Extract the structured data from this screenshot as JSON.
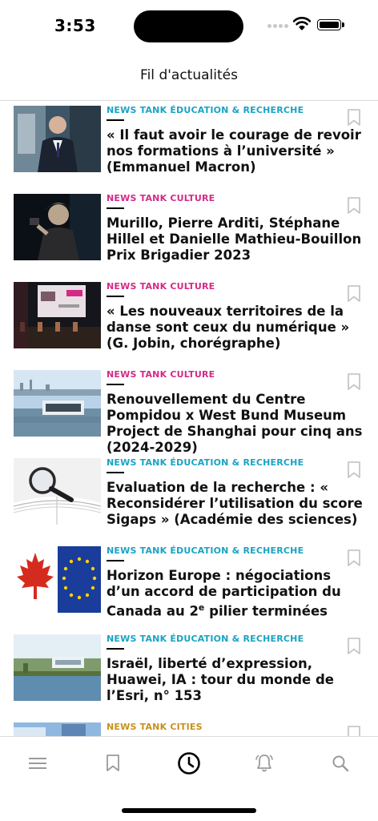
{
  "status_bar": {
    "time": "3:53"
  },
  "nav": {
    "title": "Fil d'actualités"
  },
  "colors": {
    "education": "#1aa3c4",
    "culture": "#d42a86",
    "cities": "#c8901a"
  },
  "feed": {
    "items": [
      {
        "category": "NEWS TANK ÉDUCATION & RECHERCHE",
        "headline": "« Il faut avoir le courage de revoir nos formations à l’université » (Emmanuel Macron)"
      },
      {
        "category": "NEWS TANK CULTURE",
        "headline": "Murillo, Pierre Arditi, Stéphane Hillel et Danielle Mathieu-Bouillon Prix Brigadier 2023"
      },
      {
        "category": "NEWS TANK CULTURE",
        "headline": "« Les nouveaux territoires de la danse sont ceux du numérique » (G. Jobin, chorégraphe)"
      },
      {
        "category": "NEWS TANK CULTURE",
        "headline": "Renouvellement du Centre Pompidou x West Bund Museum Project de Shanghai pour cinq ans (2024-2029)"
      },
      {
        "category": "NEWS TANK ÉDUCATION & RECHERCHE",
        "headline": "Evaluation de la recherche : « Reconsidérer l’utilisation du score Sigaps » (Académie des sciences)"
      },
      {
        "category": "NEWS TANK ÉDUCATION & RECHERCHE",
        "headline_main": "Horizon Europe : négociations d’un accord de participation du Canada au 2",
        "headline_sup": "e",
        "headline_end": " pilier terminées"
      },
      {
        "category": "NEWS TANK ÉDUCATION & RECHERCHE",
        "headline": "Israël, liberté d’expression, Huawei, IA : tour du monde de l’Esri, n° 153"
      },
      {
        "category": "NEWS TANK CITIES",
        "headline": ""
      }
    ]
  },
  "tabbar": {
    "tabs": [
      {
        "icon": "menu-icon",
        "active": false
      },
      {
        "icon": "bookmark-icon",
        "active": false
      },
      {
        "icon": "clock-icon",
        "active": true
      },
      {
        "icon": "bell-icon",
        "active": false
      },
      {
        "icon": "search-icon",
        "active": false
      }
    ]
  }
}
